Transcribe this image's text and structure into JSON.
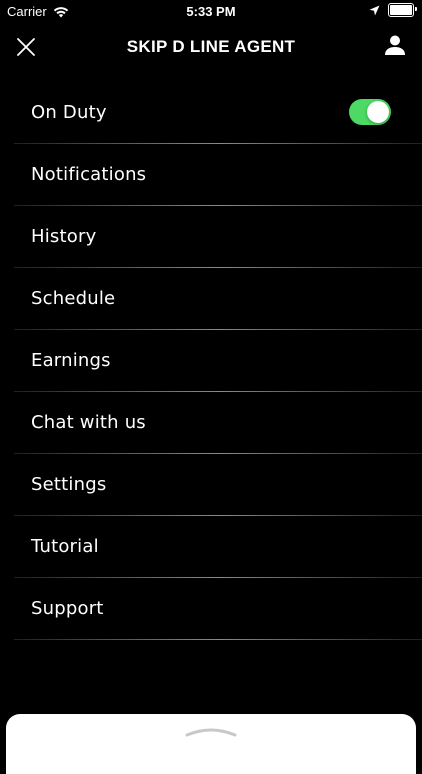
{
  "status_bar": {
    "carrier": "Carrier",
    "time": "5:33 PM",
    "battery_level": 1.0,
    "icons": [
      "wifi-icon",
      "location-arrow-icon",
      "battery-icon"
    ]
  },
  "header": {
    "title": "SKIP D LINE AGENT",
    "close_icon": "close-icon",
    "profile_icon": "person-icon"
  },
  "menu": {
    "items": [
      {
        "label": "On Duty",
        "toggle": true
      },
      {
        "label": "Notifications"
      },
      {
        "label": "History"
      },
      {
        "label": "Schedule"
      },
      {
        "label": "Earnings"
      },
      {
        "label": "Chat with us"
      },
      {
        "label": "Settings"
      },
      {
        "label": "Tutorial"
      },
      {
        "label": "Support"
      }
    ]
  },
  "colors": {
    "background": "#000000",
    "toggle_on": "#4cd964",
    "text": "#ffffff",
    "sheet": "#ffffff"
  }
}
